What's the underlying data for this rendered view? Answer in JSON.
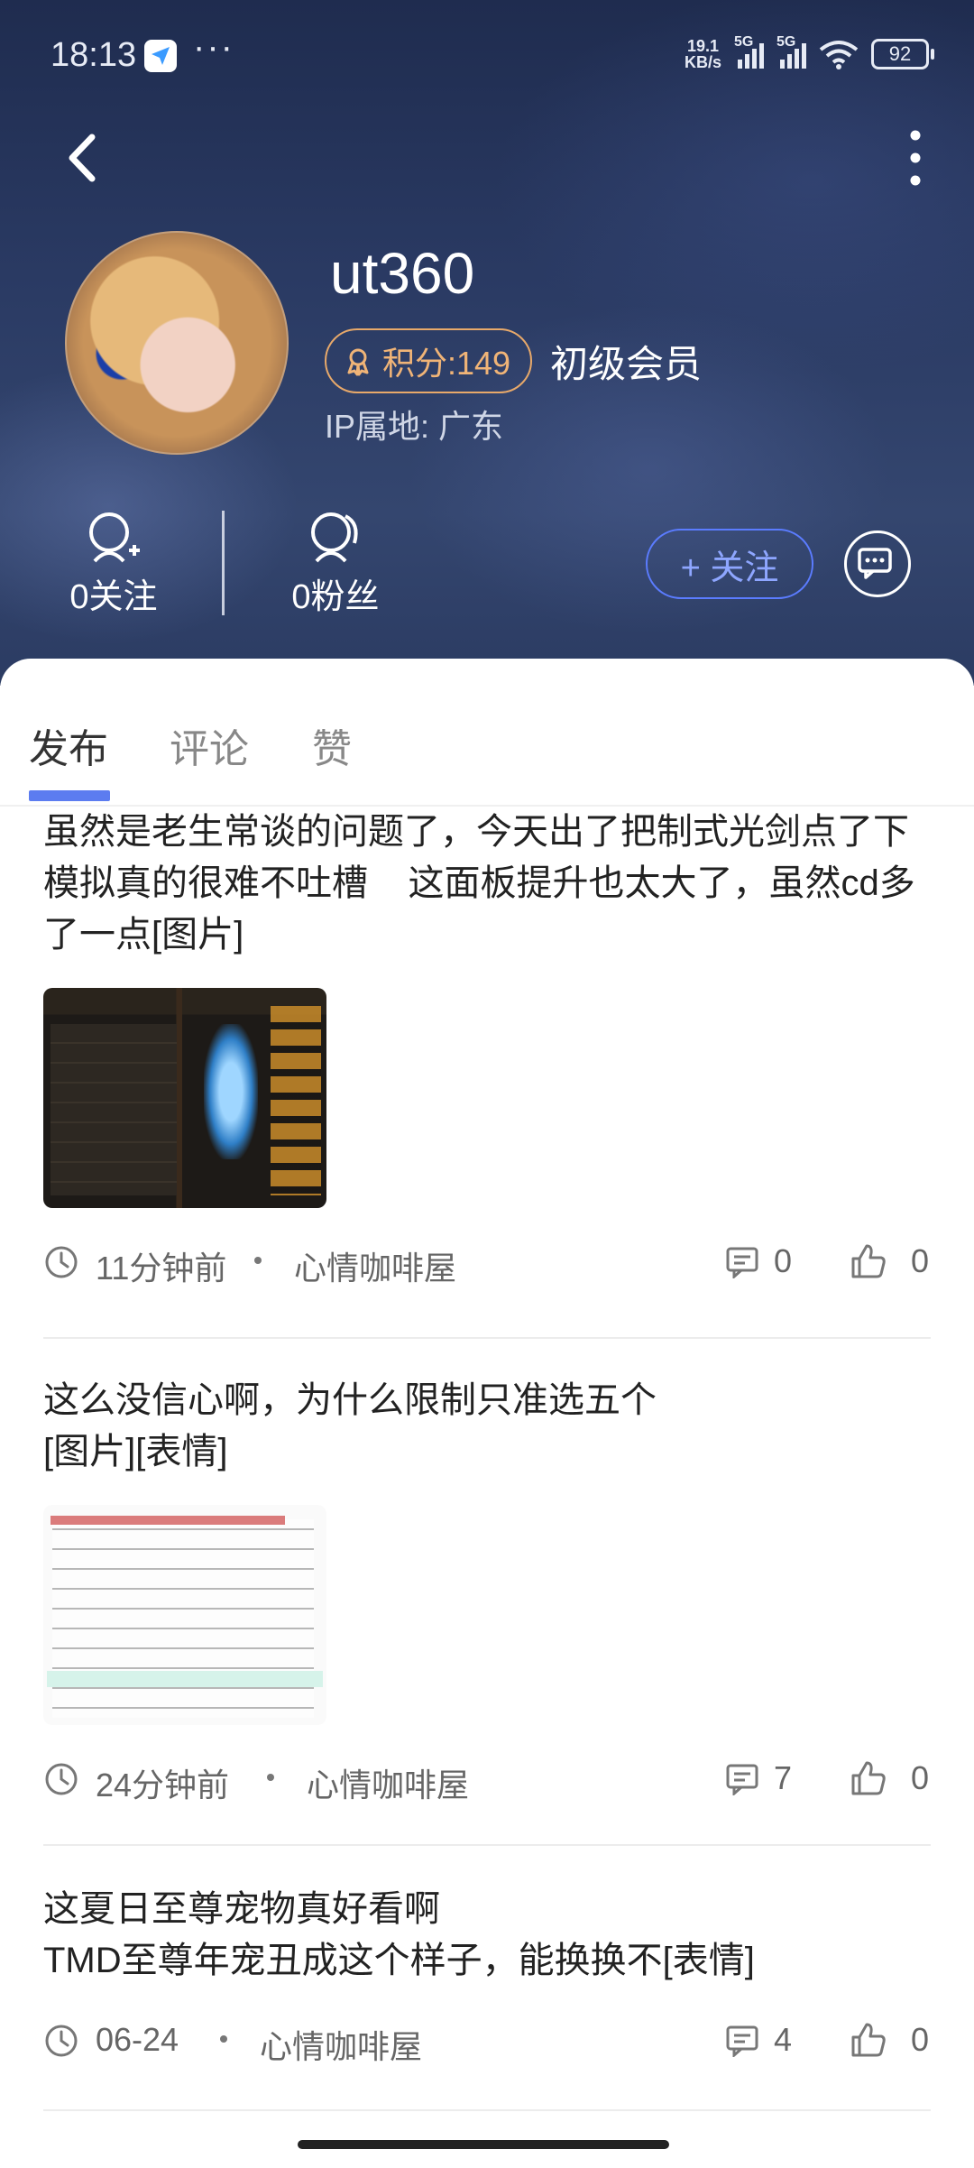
{
  "status_bar": {
    "time": "18:13",
    "dots": "···",
    "net_speed_top": "19.1",
    "net_speed_bottom": "KB/s",
    "sig1_label": "5G",
    "sig2_label": "5G",
    "battery": "92"
  },
  "profile": {
    "username": "ut360",
    "score_label": "积分:149",
    "level": "初级会员",
    "ip_location": "IP属地: 广东",
    "following": "0关注",
    "fans": "0粉丝",
    "follow_button": "+ 关注"
  },
  "tabs": [
    {
      "label": "发布",
      "active": true
    },
    {
      "label": "评论",
      "active": false
    },
    {
      "label": "赞",
      "active": false
    }
  ],
  "posts": [
    {
      "text": "虽然是老生常谈的问题了，今天出了把制式光剑点了下模拟真的很难不吐槽    这面板提升也太大了，虽然cd多了一点[图片]",
      "time": "11分钟前",
      "category": "心情咖啡屋",
      "comments": "0",
      "likes": "0"
    },
    {
      "text": "这么没信心啊，为什么限制只准选五个\n[图片][表情]",
      "time": "24分钟前",
      "category": "心情咖啡屋",
      "comments": "7",
      "likes": "0"
    },
    {
      "text": "这夏日至尊宠物真好看啊\nTMD至尊年宠丑成这个样子，能换换不[表情]",
      "time": "06-24",
      "category": "心情咖啡屋",
      "comments": "4",
      "likes": "0"
    }
  ],
  "colors": {
    "accent": "#5c7cf0",
    "badge": "#e8a96a",
    "header_bg": "#2a3a63"
  }
}
